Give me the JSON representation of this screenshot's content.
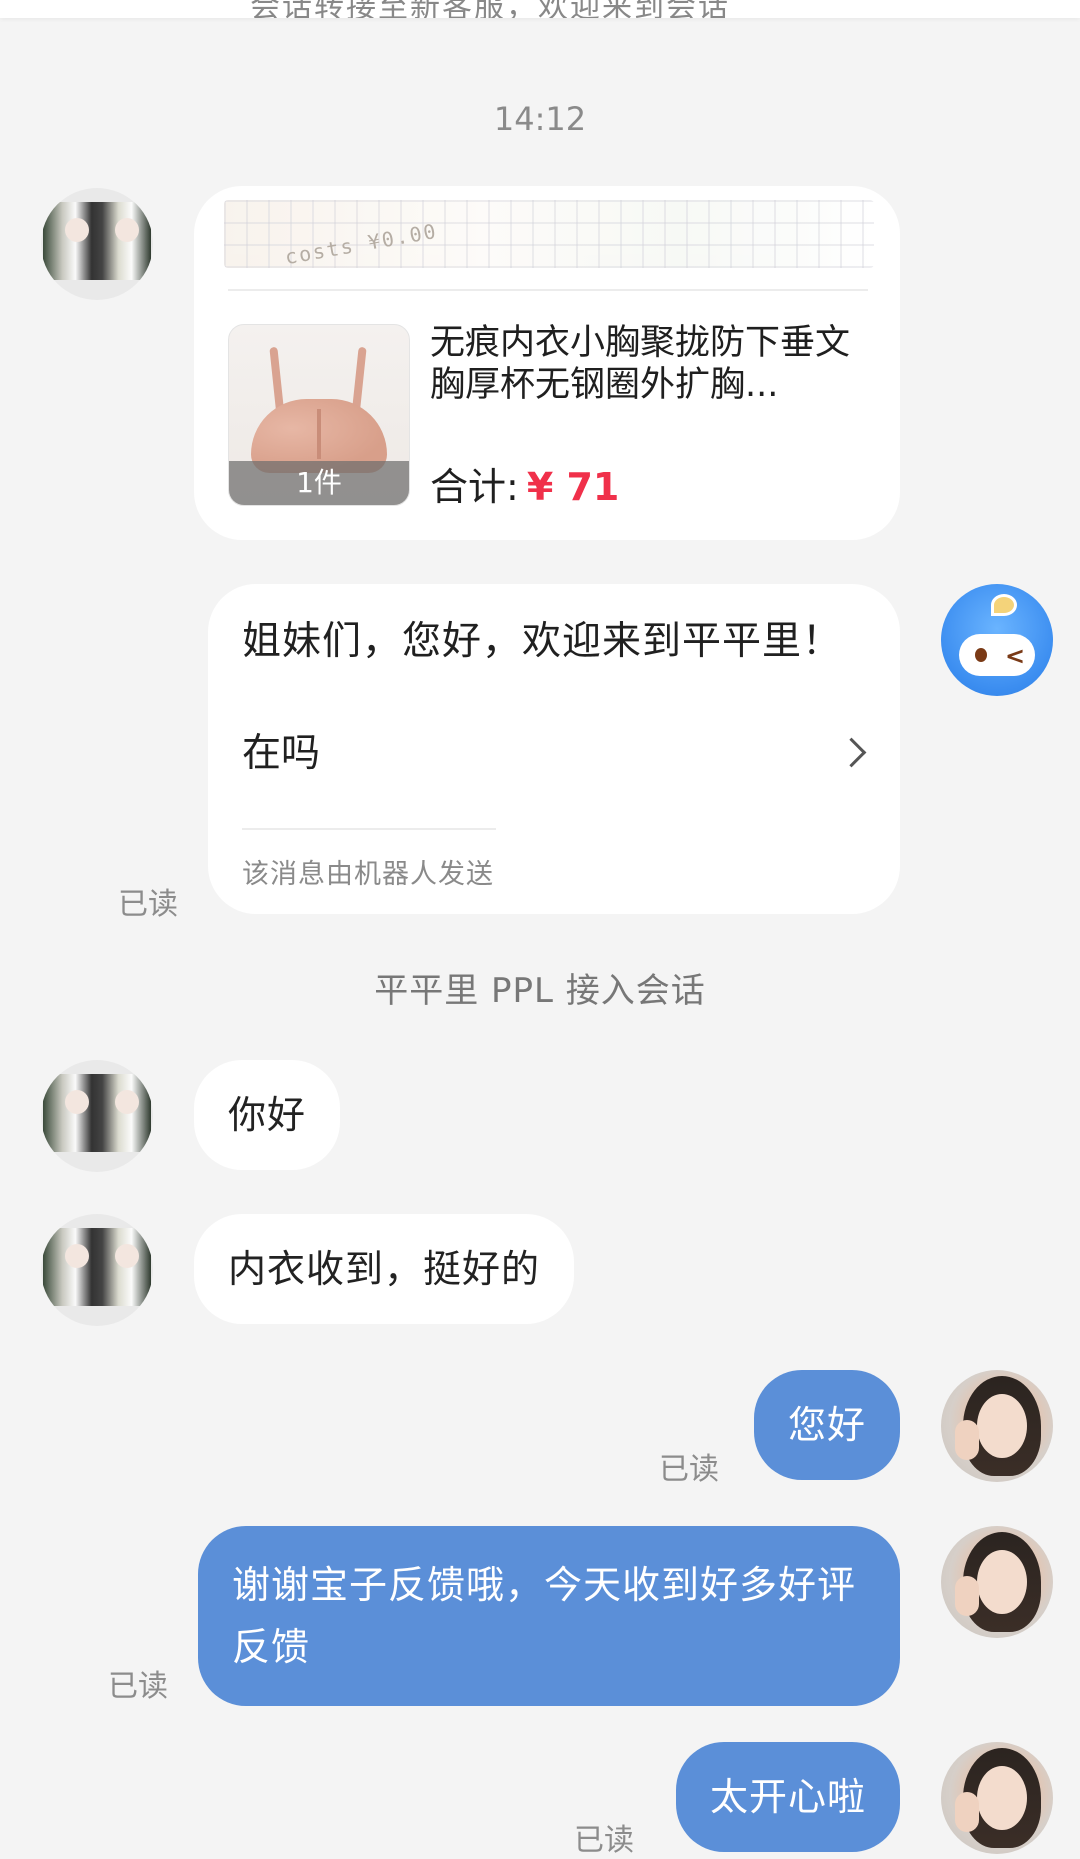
{
  "top_banner": {
    "text": "会话转接至新客服，欢迎来到会话"
  },
  "timestamp": "14:12",
  "product_card": {
    "title": "无痕内衣小胸聚拢防下垂文胸厚杯无钢圈外扩胸...",
    "quantity": "1件",
    "total_label": "合计:",
    "price": "¥ 71",
    "banner_text": "costs ¥0.00",
    "price_color": "#f0304a"
  },
  "bot_message": {
    "greeting": "姐妹们，您好，欢迎来到平平里！",
    "option": "在吗",
    "footnote": "该消息由机器人发送"
  },
  "system_line": "平平里 PPL 接入会话",
  "messages": {
    "customer_1": "你好",
    "customer_2": "内衣收到，挺好的",
    "agent_1": "您好",
    "agent_2": "谢谢宝子反馈哦，今天收到好多好评反馈",
    "agent_3": "太开心啦"
  },
  "read_label": "已读",
  "colors": {
    "background": "#f4f4f4",
    "agent_bubble": "#5b8fd8",
    "customer_bubble": "#ffffff"
  }
}
